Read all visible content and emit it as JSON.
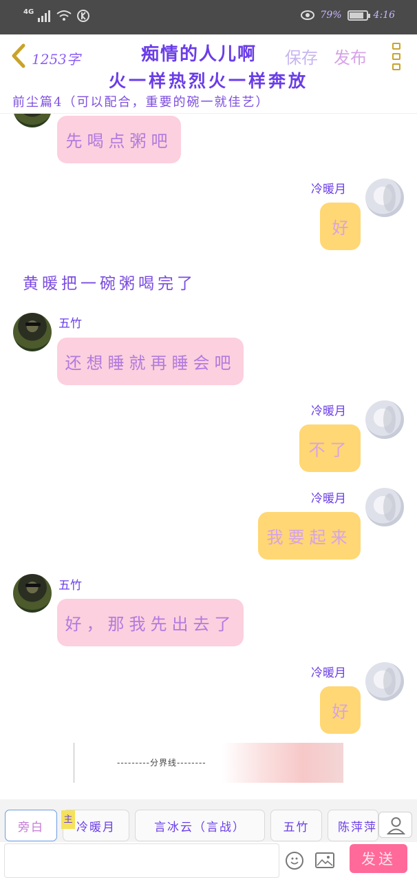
{
  "status_bar": {
    "network": "4G",
    "battery_percent": "79%",
    "battery_level": 0.79,
    "time": "4:16"
  },
  "top_bar": {
    "word_count": "1253字",
    "title": "痴情的人儿啊",
    "save_label": "保存",
    "publish_label": "发布"
  },
  "banner": {
    "line": "火一样热烈火一样奔放",
    "subtitle": "前尘篇4（可以配合，重要的碗一就佳艺）"
  },
  "messages": [
    {
      "speaker": "",
      "text": "先喝点粥吧",
      "side": "left"
    },
    {
      "speaker": "冷暖月",
      "text": "好",
      "side": "right"
    },
    {
      "narration": "黄暖把一碗粥喝完了"
    },
    {
      "speaker": "五竹",
      "text": "还想睡就再睡会吧",
      "side": "left"
    },
    {
      "speaker": "冷暖月",
      "text": "不了",
      "side": "right"
    },
    {
      "speaker": "冷暖月",
      "text": "我要起来",
      "side": "right"
    },
    {
      "speaker": "五竹",
      "text": "好，那我先出去了",
      "side": "left"
    },
    {
      "speaker": "冷暖月",
      "text": "好",
      "side": "right"
    }
  ],
  "separator": {
    "text": "---------分界线--------"
  },
  "roles": [
    {
      "label": "旁白",
      "active": true
    },
    {
      "label": "冷暖月",
      "active": false,
      "tag": "主"
    },
    {
      "label": "言冰云（言战）",
      "active": false
    },
    {
      "label": "五竹",
      "active": false
    },
    {
      "label": "陈萍萍",
      "active": false
    }
  ],
  "input": {
    "value": "",
    "placeholder": ""
  },
  "send_label": "发送",
  "colors": {
    "accent_purple": "#6a3de8",
    "bubble_pink": "#fcd0de",
    "bubble_yellow": "#ffd774",
    "send_pink": "#ff6a9a"
  }
}
